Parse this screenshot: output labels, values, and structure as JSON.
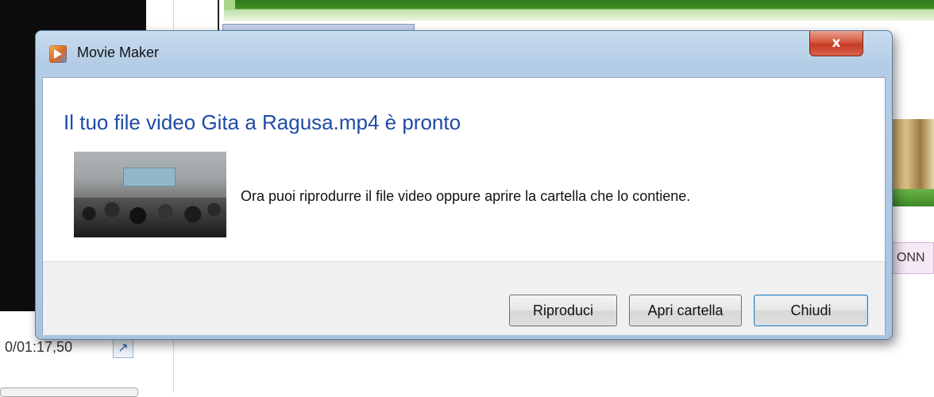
{
  "background": {
    "thumb_label": "ONN",
    "time_readout": "0/01:17,50",
    "expand_icon": "expand-arrow-icon"
  },
  "dialog": {
    "title": "Movie Maker",
    "app_icon": "movie-maker-icon",
    "close_glyph": "x",
    "close_icon": "close-icon",
    "instruction": "Il tuo file video Gita a Ragusa.mp4 è pronto",
    "message": "Ora puoi riprodurre il file video oppure aprire la cartella che lo contiene.",
    "buttons": {
      "play": "Riproduci",
      "open_folder": "Apri cartella",
      "close": "Chiudi"
    }
  },
  "colors": {
    "instruction_text": "#1f4ba5",
    "close_button": "#c43c24",
    "timeline_green": "#3e8e22"
  }
}
